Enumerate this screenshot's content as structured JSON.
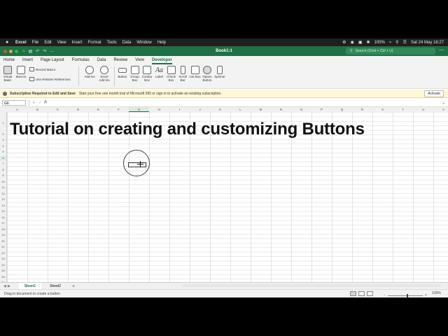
{
  "menubar": {
    "app": "Excel",
    "items": [
      "File",
      "Edit",
      "View",
      "Insert",
      "Format",
      "Tools",
      "Data",
      "Window",
      "Help"
    ],
    "battery": "100%",
    "datetime": "Sat 24 May  16:27"
  },
  "titlebar": {
    "title": "Book1:1",
    "search_placeholder": "Search (Cmd + Ctrl + U)"
  },
  "ribbon_tabs": [
    "Home",
    "Insert",
    "Page Layout",
    "Formulas",
    "Data",
    "Review",
    "View",
    "Developer"
  ],
  "active_tab": "Developer",
  "ribbon": {
    "visual_basic": "Visual Basic",
    "macros": "Macros",
    "record_macro": "Record Macro",
    "relative_refs": "Use Relative References",
    "add_ins": "Add-ins",
    "excel_add_ins": "Excel Add-ins",
    "controls": [
      "Button",
      "Group Box",
      "Combo Box",
      "Label",
      "Check Box",
      "Scroll Bar",
      "List Box",
      "Option Button",
      "Spinner"
    ]
  },
  "message_bar": {
    "title": "Subscription Required to Edit and Save",
    "text": "Start your free one month trial of Microsoft 365 or sign in to activate an existing subscription.",
    "activate": "Activate"
  },
  "formula_bar": {
    "name_box": "G6",
    "fx": "fx"
  },
  "columns": [
    "A",
    "B",
    "C",
    "D",
    "E",
    "F",
    "G",
    "H",
    "I",
    "J",
    "K",
    "L",
    "M",
    "N",
    "O",
    "P",
    "Q",
    "R",
    "S",
    "T",
    "U",
    "V"
  ],
  "selected_column": "G",
  "rows": [
    "1",
    "2",
    "3",
    "4",
    "5",
    "6",
    "7",
    "8",
    "9",
    "10",
    "11",
    "12",
    "13",
    "14",
    "15",
    "16",
    "17",
    "18",
    "19",
    "20",
    "21",
    "22",
    "23",
    "24",
    "25",
    "26",
    "27",
    "28",
    "29"
  ],
  "selected_row": "6",
  "overlay_title": "Tutorial on creating and customizing Buttons",
  "sheets": [
    "Sheet1",
    "Sheet2"
  ],
  "active_sheet": "Sheet1",
  "status": {
    "message": "Drag in document to create a button",
    "zoom": "100%"
  },
  "colors": {
    "excel_green": "#1e7145",
    "message_bar": "#fff6d5"
  }
}
